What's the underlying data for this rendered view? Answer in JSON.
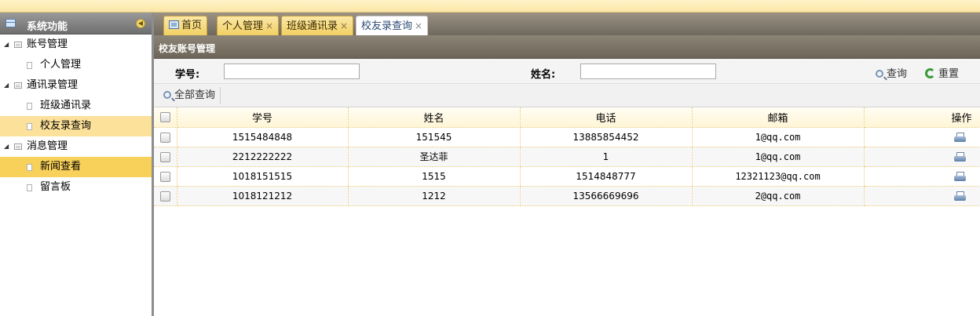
{
  "sidebar": {
    "title": "系统功能",
    "groups": [
      {
        "label": "账号管理",
        "items": [
          "个人管理"
        ]
      },
      {
        "label": "通讯录管理",
        "items": [
          "班级通讯录",
          "校友录查询"
        ]
      },
      {
        "label": "消息管理",
        "items": [
          "新闻查看",
          "留言板"
        ]
      }
    ],
    "selected_item": "校友录查询",
    "hover_item": "新闻查看"
  },
  "tabs": [
    {
      "label": "首页",
      "closable": false,
      "icon": "home-icon"
    },
    {
      "label": "个人管理",
      "closable": true
    },
    {
      "label": "班级通讯录",
      "closable": true
    },
    {
      "label": "校友录查询",
      "closable": true,
      "active": true
    }
  ],
  "close_glyph": "×",
  "panel": {
    "title": "校友账号管理"
  },
  "search": {
    "student_id_label": "学号:",
    "student_id_value": "",
    "name_label": "姓名:",
    "name_value": "",
    "query_button": "查询",
    "reset_button": "重置"
  },
  "toolbar": {
    "query_all_button": "全部查询"
  },
  "table": {
    "columns": [
      "学号",
      "姓名",
      "电话",
      "邮箱",
      "操作"
    ],
    "rows": [
      {
        "id": "1515484848",
        "name": "151545",
        "phone": "13885854452",
        "email": "1@qq.com"
      },
      {
        "id": "2212222222",
        "name": "圣达菲",
        "phone": "1",
        "email": "1@qq.com"
      },
      {
        "id": "1018151515",
        "name": "1515",
        "phone": "1514848777",
        "email": "12321123@qq.com"
      },
      {
        "id": "1018121212",
        "name": "1212",
        "phone": "13566669696",
        "email": "2@qq.com"
      }
    ]
  },
  "colors": {
    "accent": "#f8d15a",
    "selected_light": "#fbe19a",
    "header_bar": "#7a7266"
  }
}
